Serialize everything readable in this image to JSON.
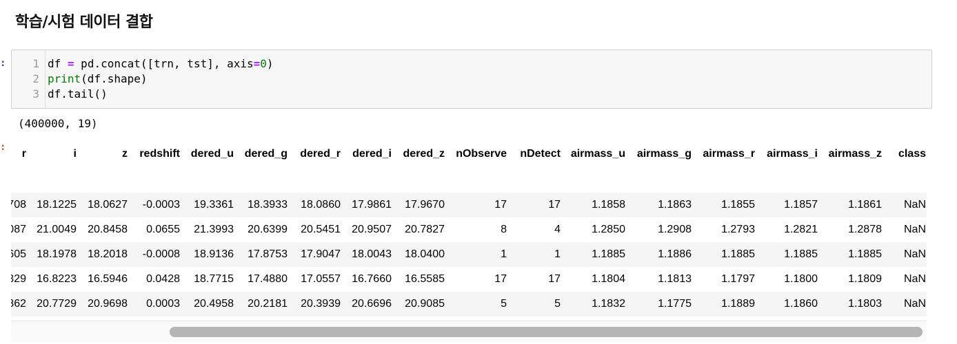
{
  "heading": "학습/시험 데이터 결합",
  "prompts": {
    "input": ":",
    "output": ":"
  },
  "code": {
    "line_numbers": [
      "1",
      "2",
      "3"
    ],
    "line1": {
      "a": "df ",
      "op": "=",
      "b": " pd.concat([trn, tst], axis",
      "op2": "=",
      "num": "0",
      "c": ")"
    },
    "line2": {
      "fn": "print",
      "rest": "(df.shape)"
    },
    "line3": "df.tail()"
  },
  "stdout": "(400000, 19)",
  "table": {
    "columns": [
      "r",
      "i",
      "z",
      "redshift",
      "dered_u",
      "dered_g",
      "dered_r",
      "dered_i",
      "dered_z",
      "nObserve",
      "nDetect",
      "airmass_u",
      "airmass_g",
      "airmass_r",
      "airmass_i",
      "airmass_z",
      "class"
    ],
    "rows": [
      [
        "708",
        "18.1225",
        "18.0627",
        "-0.0003",
        "19.3361",
        "18.3933",
        "18.0860",
        "17.9861",
        "17.9670",
        "17",
        "17",
        "1.1858",
        "1.1863",
        "1.1855",
        "1.1857",
        "1.1861",
        "NaN"
      ],
      [
        "087",
        "21.0049",
        "20.8458",
        "0.0655",
        "21.3993",
        "20.6399",
        "20.5451",
        "20.9507",
        "20.7827",
        "8",
        "4",
        "1.2850",
        "1.2908",
        "1.2793",
        "1.2821",
        "1.2878",
        "NaN"
      ],
      [
        "605",
        "18.1978",
        "18.2018",
        "-0.0008",
        "18.9136",
        "17.8753",
        "17.9047",
        "18.0043",
        "18.0400",
        "1",
        "1",
        "1.1885",
        "1.1886",
        "1.1885",
        "1.1885",
        "1.1885",
        "NaN"
      ],
      [
        "329",
        "16.8223",
        "16.5946",
        "0.0428",
        "18.7715",
        "17.4880",
        "17.0557",
        "16.7660",
        "16.5585",
        "17",
        "17",
        "1.1804",
        "1.1813",
        "1.1797",
        "1.1800",
        "1.1809",
        "NaN"
      ],
      [
        "862",
        "20.7729",
        "20.9698",
        "0.0003",
        "20.4958",
        "20.2181",
        "20.3939",
        "20.6696",
        "20.9085",
        "5",
        "5",
        "1.1832",
        "1.1775",
        "1.1889",
        "1.1860",
        "1.1803",
        "NaN"
      ]
    ]
  },
  "colors": {
    "row_stripe": "#f5f5f5",
    "keyword": "#008000",
    "operator": "#aa22ff",
    "prompt_in": "#303f9f",
    "prompt_out": "#d84315"
  }
}
